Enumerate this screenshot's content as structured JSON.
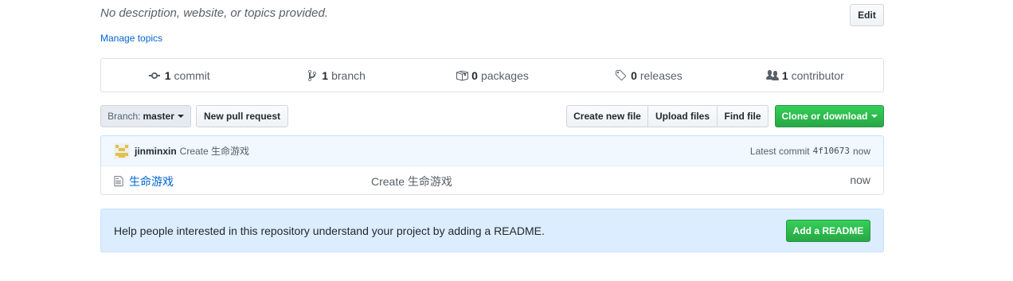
{
  "repo": {
    "description": "No description, website, or topics provided.",
    "edit_label": "Edit",
    "manage_topics": "Manage topics"
  },
  "summary": {
    "commits": {
      "count": "1",
      "label": "commit",
      "icon": "commit-icon"
    },
    "branches": {
      "count": "1",
      "label": "branch",
      "icon": "branch-icon"
    },
    "packages": {
      "count": "0",
      "label": "packages",
      "icon": "package-icon"
    },
    "releases": {
      "count": "0",
      "label": "releases",
      "icon": "tag-icon"
    },
    "contributors": {
      "count": "1",
      "label": "contributor",
      "icon": "people-icon"
    }
  },
  "toolbar": {
    "branch_prefix": "Branch:",
    "branch_name": "master",
    "new_pull_request": "New pull request",
    "create_new_file": "Create new file",
    "upload_files": "Upload files",
    "find_file": "Find file",
    "clone_or_download": "Clone or download"
  },
  "latest_commit": {
    "author": "jinminxin",
    "message": "Create 生命游戏",
    "prefix": "Latest commit",
    "sha": "4f10673",
    "age": "now"
  },
  "files": [
    {
      "name": "生命游戏",
      "message": "Create 生命游戏",
      "age": "now",
      "icon": "file-icon"
    }
  ],
  "readme_banner": {
    "text": "Help people interested in this repository understand your project by adding a README.",
    "button": "Add a README"
  },
  "colors": {
    "link": "#0366d6",
    "primary_green": "#28a745",
    "commit_bar_bg": "#f1f8ff",
    "readme_bg": "#dbedff"
  }
}
